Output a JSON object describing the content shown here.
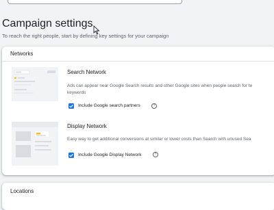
{
  "header": {
    "title": "Campaign settings",
    "subtitle": "To reach the right people, start by defining key settings for your campaign"
  },
  "networks": {
    "title": "Networks",
    "search": {
      "title": "Search Network",
      "description_line1": "Ads can appear near Google Search results and other Google sites when people search for te",
      "description_line2": "keywords",
      "checkbox_label": "Include Google search partners",
      "checked": true,
      "help_icon": "question-circle-icon"
    },
    "display": {
      "title": "Display Network",
      "description_line1": "Easy way to get additional conversions at similar or lower costs than Search with unused Sea",
      "checkbox_label": "Include Google Display Network",
      "checked": true,
      "help_icon": "question-circle-icon"
    }
  },
  "locations": {
    "title": "Locations"
  },
  "colors": {
    "accent": "#1a73e8",
    "illustration_yellow": "#fbbc04"
  }
}
